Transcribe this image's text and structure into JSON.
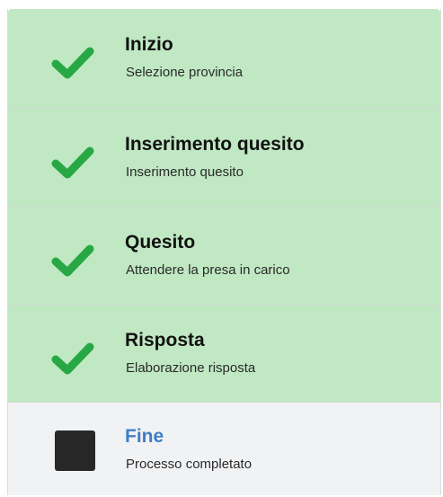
{
  "stepper": {
    "steps": [
      {
        "title": "Inizio",
        "subtitle": "Selezione provincia",
        "status": "completed",
        "icon": "checkmark-icon"
      },
      {
        "title": "Inserimento quesito",
        "subtitle": "Inserimento quesito",
        "status": "completed",
        "icon": "checkmark-icon"
      },
      {
        "title": "Quesito",
        "subtitle": "Attendere la presa in carico",
        "status": "completed",
        "icon": "checkmark-icon"
      },
      {
        "title": "Risposta",
        "subtitle": "Elaborazione risposta",
        "status": "completed",
        "icon": "checkmark-icon"
      },
      {
        "title": "Fine",
        "subtitle": "Processo completato",
        "status": "current",
        "icon": "square-icon"
      }
    ]
  },
  "colors": {
    "completed_background": "#c0e8c3",
    "current_background": "#f1f2f4",
    "check_green": "#27a844",
    "current_title": "#3f7ec6"
  }
}
